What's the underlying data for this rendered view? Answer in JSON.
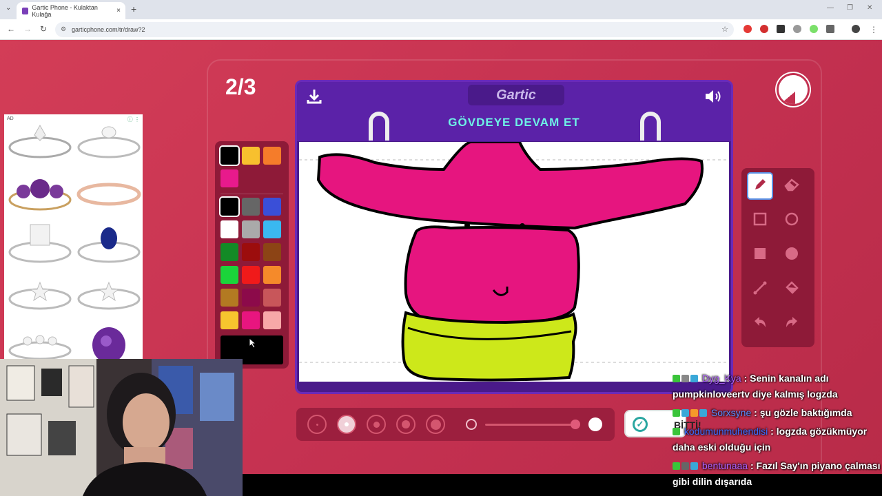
{
  "browser": {
    "tab_title": "Gartic Phone - Kulaktan Kulağa",
    "tab_close": "×",
    "new_tab": "+",
    "url": "garticphone.com/tr/draw?2"
  },
  "game": {
    "round": "2/3",
    "logo": "Gartic",
    "instruction": "GÖVDEYE DEVAM ET",
    "done_label": "BİTTİ!",
    "timer_fraction_remaining": 0.86
  },
  "palette": {
    "recent": [
      "#000000",
      "#f7c02e",
      "#f57c2a",
      "#e81a8c"
    ],
    "colors": [
      [
        "#000000",
        "#666666",
        "#3a4fd8"
      ],
      [
        "#ffffff",
        "#aaaaaa",
        "#3ab8f0"
      ],
      [
        "#138a26",
        "#9c0d0d",
        "#8c4415"
      ],
      [
        "#1bd43a",
        "#f01a1a",
        "#f58a2a"
      ],
      [
        "#b37a22",
        "#8c0a4a",
        "#c8565a"
      ],
      [
        "#f7c52e",
        "#e8157f",
        "#f7a8a8"
      ]
    ],
    "current": "#000000",
    "accent": "#8e1a38"
  },
  "tools": [
    {
      "name": "pencil-tool",
      "icon": "pencil-icon",
      "selected": true
    },
    {
      "name": "eraser-tool",
      "icon": "eraser-icon",
      "selected": false
    },
    {
      "name": "rectangle-outline-tool",
      "icon": "square-outline-icon",
      "selected": false
    },
    {
      "name": "ellipse-outline-tool",
      "icon": "circle-outline-icon",
      "selected": false
    },
    {
      "name": "rectangle-fill-tool",
      "icon": "square-filled-icon",
      "selected": false
    },
    {
      "name": "ellipse-fill-tool",
      "icon": "circle-filled-icon",
      "selected": false
    },
    {
      "name": "line-tool",
      "icon": "line-icon",
      "selected": false
    },
    {
      "name": "fill-bucket-tool",
      "icon": "bucket-icon",
      "selected": false
    },
    {
      "name": "undo-tool",
      "icon": "undo-icon",
      "selected": false
    },
    {
      "name": "redo-tool",
      "icon": "redo-icon",
      "selected": false
    }
  ],
  "brush": {
    "sizes": 5,
    "selected_size_index": 1,
    "opacity_level": 0.95
  },
  "ad": {
    "label": "AD",
    "info": "ⓘ ⋮"
  },
  "chat": [
    {
      "user": "Dyg_Kya",
      "color": "#b061ff",
      "text": "Senin kanalın adı pumpkinloveertv diye kalmış logzda"
    },
    {
      "user": "Sorxsyne",
      "color": "#5a8cff",
      "text": "şu gözle baktığımda"
    },
    {
      "user": "kodumunmuhendisi",
      "color": "#3a6cff",
      "text": "logzda gözükmüyor daha eski olduğu için"
    },
    {
      "user": "bentunaaa",
      "color": "#b061ff",
      "text": "Fazıl Say'ın piyano çalması gibi dilin dışarıda"
    }
  ]
}
